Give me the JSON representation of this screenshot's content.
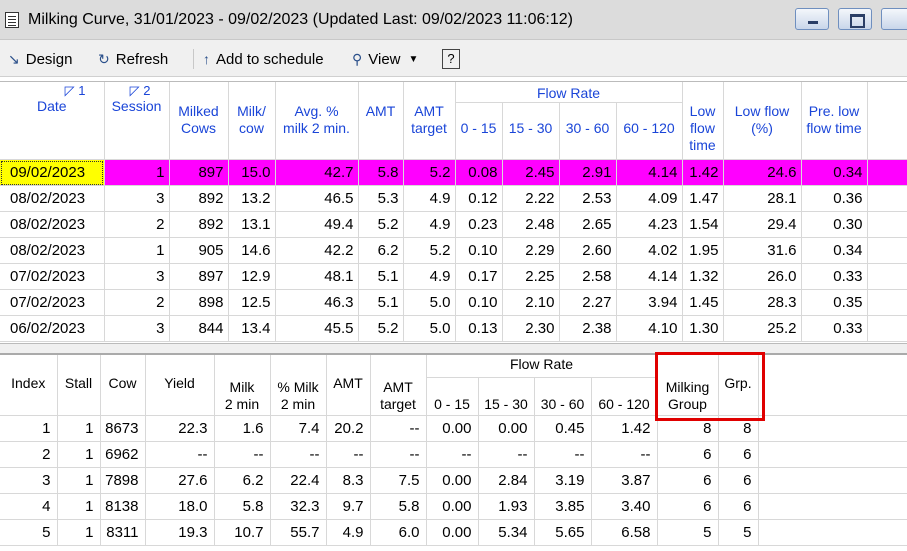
{
  "window": {
    "title": "Milking Curve, 31/01/2023 - 09/02/2023 (Updated Last: 09/02/2023 11:06:12)"
  },
  "toolbar": {
    "design": "Design",
    "refresh": "Refresh",
    "add_to_schedule": "Add to schedule",
    "view": "View",
    "help": "?"
  },
  "top_table": {
    "headers": {
      "date": "Date",
      "date_sort": "◸ 1",
      "session": "Session",
      "session_sort": "◸ 2",
      "milked_cows_1": "Milked",
      "milked_cows_2": "Cows",
      "milk_cow_1": "Milk/",
      "milk_cow_2": "cow",
      "avg_1": "Avg. %",
      "avg_2": "milk 2 min.",
      "amt": "AMT",
      "amt_target_1": "AMT",
      "amt_target_2": "target",
      "flow_rate": "Flow Rate",
      "fr_0_15": "0 - 15",
      "fr_15_30": "15 - 30",
      "fr_30_60": "30 - 60",
      "fr_60_120": "60 - 120",
      "low_flow_time_1": "Low",
      "low_flow_time_2": "flow",
      "low_flow_time_3": "time",
      "low_flow_pct_1": "Low flow",
      "low_flow_pct_2": "(%)",
      "pre_low_1": "Pre. low",
      "pre_low_2": "flow time"
    },
    "rows": [
      [
        "09/02/2023",
        "1",
        "897",
        "15.0",
        "42.7",
        "5.8",
        "5.2",
        "0.08",
        "2.45",
        "2.91",
        "4.14",
        "1.42",
        "24.6",
        "0.34"
      ],
      [
        "08/02/2023",
        "3",
        "892",
        "13.2",
        "46.5",
        "5.3",
        "4.9",
        "0.12",
        "2.22",
        "2.53",
        "4.09",
        "1.47",
        "28.1",
        "0.36"
      ],
      [
        "08/02/2023",
        "2",
        "892",
        "13.1",
        "49.4",
        "5.2",
        "4.9",
        "0.23",
        "2.48",
        "2.65",
        "4.23",
        "1.54",
        "29.4",
        "0.30"
      ],
      [
        "08/02/2023",
        "1",
        "905",
        "14.6",
        "42.2",
        "6.2",
        "5.2",
        "0.10",
        "2.29",
        "2.60",
        "4.02",
        "1.95",
        "31.6",
        "0.34"
      ],
      [
        "07/02/2023",
        "3",
        "897",
        "12.9",
        "48.1",
        "5.1",
        "4.9",
        "0.17",
        "2.25",
        "2.58",
        "4.14",
        "1.32",
        "26.0",
        "0.33"
      ],
      [
        "07/02/2023",
        "2",
        "898",
        "12.5",
        "46.3",
        "5.1",
        "5.0",
        "0.10",
        "2.10",
        "2.27",
        "3.94",
        "1.45",
        "28.3",
        "0.35"
      ],
      [
        "06/02/2023",
        "3",
        "844",
        "13.4",
        "45.5",
        "5.2",
        "5.0",
        "0.13",
        "2.30",
        "2.38",
        "4.10",
        "1.30",
        "25.2",
        "0.33"
      ]
    ]
  },
  "bottom_table": {
    "headers": {
      "index": "Index",
      "stall": "Stall",
      "cow": "Cow",
      "yield": "Yield",
      "milk2_1": "Milk",
      "milk2_2": "2 min",
      "pmilk2_1": "% Milk",
      "pmilk2_2": "2 min",
      "amt": "AMT",
      "amt_target_1": "AMT",
      "amt_target_2": "target",
      "flow_rate": "Flow Rate",
      "fr_0_15": "0 - 15",
      "fr_15_30": "15 - 30",
      "fr_30_60": "30 - 60",
      "fr_60_120": "60 - 120",
      "milking_group_1": "Milking",
      "milking_group_2": "Group",
      "grp": "Grp."
    },
    "rows": [
      [
        "1",
        "1",
        "8673",
        "22.3",
        "1.6",
        "7.4",
        "20.2",
        "--",
        "0.00",
        "0.00",
        "0.45",
        "1.42",
        "8",
        "8"
      ],
      [
        "2",
        "1",
        "6962",
        "--",
        "--",
        "--",
        "--",
        "--",
        "--",
        "--",
        "--",
        "--",
        "6",
        "6"
      ],
      [
        "3",
        "1",
        "7898",
        "27.6",
        "6.2",
        "22.4",
        "8.3",
        "7.5",
        "0.00",
        "2.84",
        "3.19",
        "3.87",
        "6",
        "6"
      ],
      [
        "4",
        "1",
        "8138",
        "18.0",
        "5.8",
        "32.3",
        "9.7",
        "5.8",
        "0.00",
        "1.93",
        "3.85",
        "3.40",
        "6",
        "6"
      ],
      [
        "5",
        "1",
        "8311",
        "19.3",
        "10.7",
        "55.7",
        "4.9",
        "6.0",
        "0.00",
        "5.34",
        "5.65",
        "6.58",
        "5",
        "5"
      ]
    ]
  },
  "colors": {
    "header_text": "#1a45d8",
    "selected_row": "#ff00ff",
    "selected_date": "#ffff00",
    "annotation_box": "#e00000"
  }
}
